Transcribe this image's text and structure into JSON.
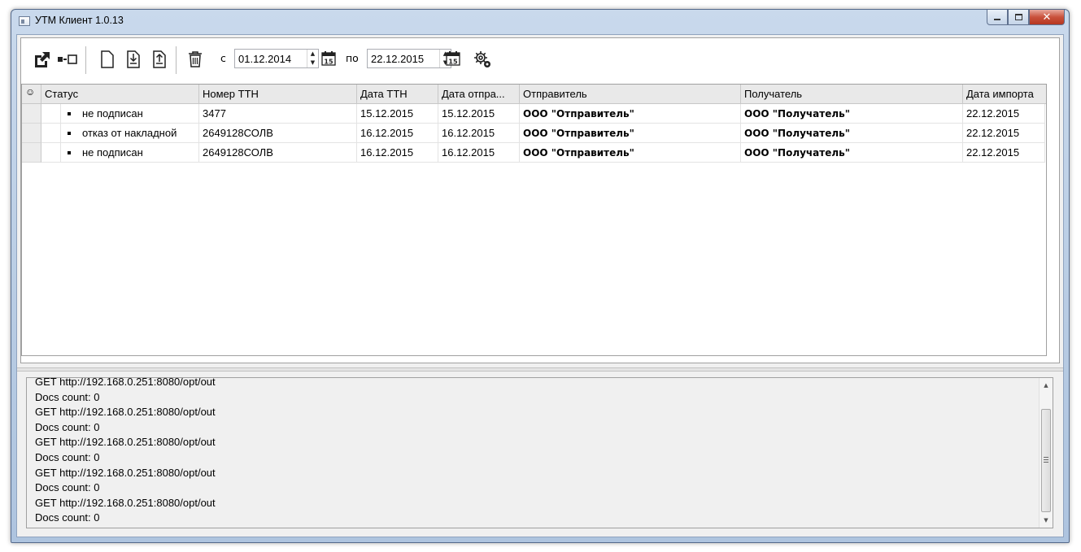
{
  "window": {
    "title": "УТМ Клиент 1.0.13",
    "close_glyph": "✕"
  },
  "toolbar": {
    "from_label": "с",
    "to_label": "по",
    "date_from": "01.12.2014",
    "date_to": "22.12.2015",
    "calendar_day": "15"
  },
  "grid": {
    "columns": [
      "☺",
      "Статус",
      "Номер ТТН",
      "Дата ТТН",
      "Дата отпра...",
      "Отправитель",
      "Получатель",
      "Дата импорта"
    ],
    "rows": [
      {
        "status": "не подписан",
        "ttn": "3477",
        "ttn_date": "15.12.2015",
        "ship_date": "15.12.2015",
        "sender": "ООО \"Отправитель\"",
        "receiver": "ООО \"Получатель\"",
        "import_date": "22.12.2015"
      },
      {
        "status": "отказ от накладной",
        "ttn": "2649128СОЛВ",
        "ttn_date": "16.12.2015",
        "ship_date": "16.12.2015",
        "sender": "ООО \"Отправитель\"",
        "receiver": "ООО \"Получатель\"",
        "import_date": "22.12.2015"
      },
      {
        "status": "не подписан",
        "ttn": "2649128СОЛВ",
        "ttn_date": "16.12.2015",
        "ship_date": "16.12.2015",
        "sender": "ООО \"Отправитель\"",
        "receiver": "ООО \"Получатель\"",
        "import_date": "22.12.2015"
      }
    ]
  },
  "log": {
    "lines": [
      "GET http://192.168.0.251:8080/opt/out",
      "Docs count: 0",
      "GET http://192.168.0.251:8080/opt/out",
      "Docs count: 0",
      "GET http://192.168.0.251:8080/opt/out",
      "Docs count: 0",
      "GET http://192.168.0.251:8080/opt/out",
      "Docs count: 0",
      "GET http://192.168.0.251:8080/opt/out",
      "Docs count: 0"
    ]
  },
  "icons": {
    "toolbar": [
      "open-external-icon",
      "toggle-panel-icon",
      "new-document-icon",
      "import-document-icon",
      "export-document-icon",
      "delete-icon",
      "calendar-icon",
      "settings-icon"
    ]
  }
}
